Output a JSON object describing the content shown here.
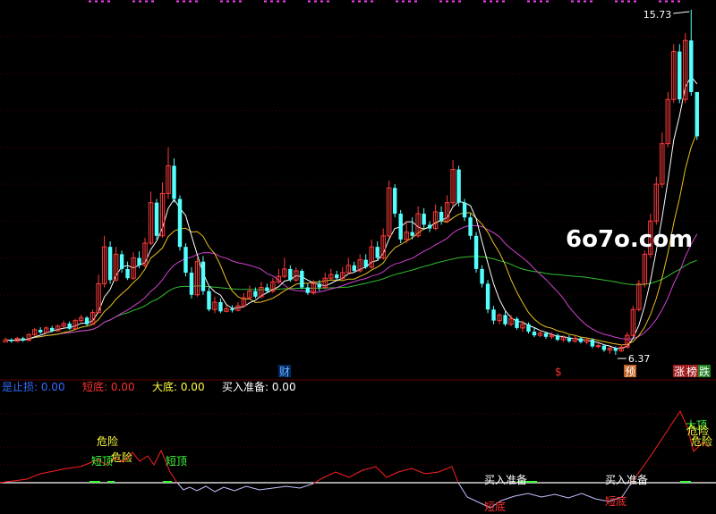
{
  "colors": {
    "background": "#000000",
    "up": "#ff3b3b",
    "down": "#54ffff",
    "ma5": "#ffffff",
    "ma10": "#e8c020",
    "ma20": "#d040d0",
    "ma60": "#30c030",
    "grid": "#4a0000",
    "indicator_red": "#ff2020",
    "indicator_blue": "#c0c0ff",
    "indicator_white": "#ffffff"
  },
  "watermark": "6o7o.com",
  "price_labels": {
    "high": "15.73",
    "low": "6.37"
  },
  "markers": {
    "cai": "财",
    "dollar": "$",
    "yu": "预",
    "zhang": "涨",
    "bang": "榜",
    "die": "跌"
  },
  "legend": [
    {
      "label": "是止损:",
      "value": "0.00",
      "color": "#2f6bff"
    },
    {
      "label": "短底:",
      "value": "0.00",
      "color": "#ff3030"
    },
    {
      "label": "大底:",
      "value": "0.00",
      "color": "#ffff40"
    },
    {
      "label": "买入准备:",
      "value": "0.00",
      "color": "#ffffff"
    }
  ],
  "signals": {
    "weixian": "危险",
    "duanding": "短顶",
    "duandi": "短底",
    "mairuzhunbei": "买入准备",
    "dading": "大顶"
  },
  "chart_data": {
    "type": "candlestick",
    "title": "",
    "ylim": [
      6.2,
      15.9
    ],
    "candles": [
      [
        6.72,
        6.78,
        6.75,
        6.84
      ],
      [
        6.78,
        6.74,
        6.7,
        6.82
      ],
      [
        6.74,
        6.82,
        6.72,
        6.86
      ],
      [
        6.82,
        6.76,
        6.72,
        6.86
      ],
      [
        6.76,
        6.92,
        6.74,
        6.96
      ],
      [
        6.92,
        7.05,
        6.88,
        7.1
      ],
      [
        7.05,
        6.98,
        6.94,
        7.12
      ],
      [
        6.98,
        7.1,
        6.95,
        7.15
      ],
      [
        7.1,
        7.02,
        6.98,
        7.16
      ],
      [
        7.02,
        7.15,
        7.0,
        7.2
      ],
      [
        7.15,
        7.22,
        7.1,
        7.3
      ],
      [
        7.22,
        7.08,
        7.05,
        7.28
      ],
      [
        7.08,
        7.3,
        7.06,
        7.35
      ],
      [
        7.3,
        7.38,
        7.25,
        7.46
      ],
      [
        7.38,
        7.2,
        7.15,
        7.42
      ],
      [
        7.2,
        7.52,
        7.18,
        7.6
      ],
      [
        7.52,
        8.3,
        7.5,
        8.55
      ],
      [
        8.3,
        9.3,
        8.2,
        9.6
      ],
      [
        9.3,
        8.4,
        8.3,
        9.45
      ],
      [
        8.4,
        9.1,
        8.35,
        9.3
      ],
      [
        9.1,
        8.7,
        8.6,
        9.2
      ],
      [
        8.7,
        8.45,
        8.4,
        8.9
      ],
      [
        8.45,
        9.0,
        8.4,
        9.15
      ],
      [
        9.0,
        8.8,
        8.72,
        9.18
      ],
      [
        8.8,
        9.4,
        8.75,
        9.55
      ],
      [
        9.4,
        10.5,
        9.35,
        10.8
      ],
      [
        10.5,
        9.6,
        9.5,
        10.6
      ],
      [
        9.6,
        10.75,
        9.55,
        11.05
      ],
      [
        10.75,
        11.5,
        10.6,
        12.0
      ],
      [
        11.5,
        10.6,
        10.5,
        11.7
      ],
      [
        10.6,
        9.3,
        9.2,
        10.7
      ],
      [
        9.3,
        8.6,
        8.5,
        9.4
      ],
      [
        8.6,
        8.0,
        7.9,
        8.75
      ],
      [
        8.0,
        8.9,
        7.95,
        9.0
      ],
      [
        8.9,
        8.1,
        8.0,
        9.05
      ],
      [
        8.1,
        7.6,
        7.55,
        8.2
      ],
      [
        7.6,
        7.8,
        7.5,
        7.95
      ],
      [
        7.8,
        7.55,
        7.5,
        7.9
      ],
      [
        7.55,
        7.62,
        7.52,
        7.72
      ],
      [
        7.62,
        7.58,
        7.52,
        7.72
      ],
      [
        7.58,
        7.7,
        7.55,
        7.8
      ],
      [
        7.7,
        7.92,
        7.65,
        8.05
      ],
      [
        7.92,
        8.1,
        7.88,
        8.25
      ],
      [
        8.1,
        7.95,
        7.9,
        8.2
      ],
      [
        7.95,
        8.2,
        7.9,
        8.35
      ],
      [
        8.2,
        8.1,
        8.05,
        8.3
      ],
      [
        8.1,
        8.35,
        8.05,
        8.45
      ],
      [
        8.35,
        8.5,
        8.3,
        8.7
      ],
      [
        8.5,
        8.7,
        8.45,
        9.0
      ],
      [
        8.7,
        8.4,
        8.35,
        8.8
      ],
      [
        8.4,
        8.65,
        8.35,
        8.75
      ],
      [
        8.65,
        8.2,
        8.15,
        8.7
      ],
      [
        8.2,
        8.05,
        8.0,
        8.3
      ],
      [
        8.05,
        8.3,
        8.0,
        8.4
      ],
      [
        8.3,
        8.2,
        8.1,
        8.4
      ],
      [
        8.2,
        8.45,
        8.15,
        8.6
      ],
      [
        8.45,
        8.55,
        8.4,
        8.7
      ],
      [
        8.55,
        8.45,
        8.4,
        8.65
      ],
      [
        8.45,
        8.6,
        8.4,
        8.75
      ],
      [
        8.6,
        8.8,
        8.55,
        9.0
      ],
      [
        8.8,
        8.65,
        8.6,
        8.9
      ],
      [
        8.65,
        8.95,
        8.6,
        9.1
      ],
      [
        8.95,
        8.75,
        8.7,
        9.1
      ],
      [
        8.75,
        9.3,
        8.7,
        9.5
      ],
      [
        9.3,
        9.0,
        8.95,
        9.45
      ],
      [
        9.0,
        9.6,
        8.95,
        9.8
      ],
      [
        9.6,
        10.9,
        9.55,
        11.1
      ],
      [
        10.9,
        10.2,
        10.1,
        11.0
      ],
      [
        10.2,
        9.5,
        9.4,
        10.3
      ],
      [
        9.5,
        9.7,
        9.4,
        10.0
      ],
      [
        9.7,
        9.6,
        9.5,
        10.1
      ],
      [
        9.6,
        10.2,
        9.55,
        10.4
      ],
      [
        10.2,
        9.9,
        9.8,
        10.35
      ],
      [
        9.9,
        9.8,
        9.7,
        10.0
      ],
      [
        9.8,
        10.25,
        9.75,
        10.45
      ],
      [
        10.25,
        10.0,
        9.9,
        10.4
      ],
      [
        10.0,
        10.5,
        9.95,
        10.7
      ],
      [
        10.5,
        11.4,
        10.4,
        11.65
      ],
      [
        11.4,
        10.5,
        10.4,
        11.5
      ],
      [
        10.5,
        10.1,
        10.0,
        10.6
      ],
      [
        10.1,
        9.6,
        9.5,
        10.2
      ],
      [
        9.6,
        8.7,
        8.6,
        9.7
      ],
      [
        8.7,
        8.3,
        8.2,
        8.8
      ],
      [
        8.3,
        7.6,
        7.5,
        8.4
      ],
      [
        7.6,
        7.3,
        7.2,
        7.7
      ],
      [
        7.3,
        7.45,
        7.2,
        7.5
      ],
      [
        7.45,
        7.2,
        7.15,
        7.55
      ],
      [
        7.2,
        7.35,
        7.15,
        7.45
      ],
      [
        7.35,
        7.1,
        7.05,
        7.4
      ],
      [
        7.1,
        7.2,
        7.0,
        7.3
      ],
      [
        7.2,
        7.0,
        6.95,
        7.25
      ],
      [
        7.0,
        6.9,
        6.85,
        7.1
      ],
      [
        6.9,
        6.96,
        6.85,
        7.05
      ],
      [
        6.96,
        6.86,
        6.8,
        7.0
      ],
      [
        6.86,
        6.9,
        6.8,
        6.98
      ],
      [
        6.9,
        6.78,
        6.74,
        6.95
      ],
      [
        6.78,
        6.84,
        6.72,
        6.9
      ],
      [
        6.84,
        6.74,
        6.7,
        6.9
      ],
      [
        6.74,
        6.82,
        6.7,
        6.88
      ],
      [
        6.82,
        6.72,
        6.68,
        6.86
      ],
      [
        6.72,
        6.78,
        6.65,
        6.85
      ],
      [
        6.78,
        6.6,
        6.55,
        6.82
      ],
      [
        6.6,
        6.62,
        6.55,
        6.7
      ],
      [
        6.62,
        6.5,
        6.45,
        6.66
      ],
      [
        6.5,
        6.55,
        6.4,
        6.6
      ],
      [
        6.55,
        6.48,
        6.37,
        6.6
      ],
      [
        6.48,
        6.58,
        6.45,
        6.65
      ],
      [
        6.58,
        6.9,
        6.55,
        6.98
      ],
      [
        6.9,
        7.6,
        6.85,
        7.7
      ],
      [
        7.6,
        8.3,
        7.55,
        8.4
      ],
      [
        8.3,
        9.1,
        8.2,
        9.2
      ],
      [
        9.1,
        10.0,
        9.0,
        10.2
      ],
      [
        10.0,
        11.0,
        9.9,
        11.2
      ],
      [
        11.0,
        12.1,
        10.9,
        12.4
      ],
      [
        12.1,
        13.3,
        12.0,
        13.5
      ],
      [
        13.3,
        14.6,
        13.2,
        14.8
      ],
      [
        14.6,
        13.3,
        13.2,
        14.8
      ],
      [
        13.3,
        14.9,
        13.2,
        15.1
      ],
      [
        14.9,
        13.5,
        13.4,
        15.73
      ],
      [
        13.5,
        12.3,
        12.2,
        12.7
      ]
    ]
  }
}
